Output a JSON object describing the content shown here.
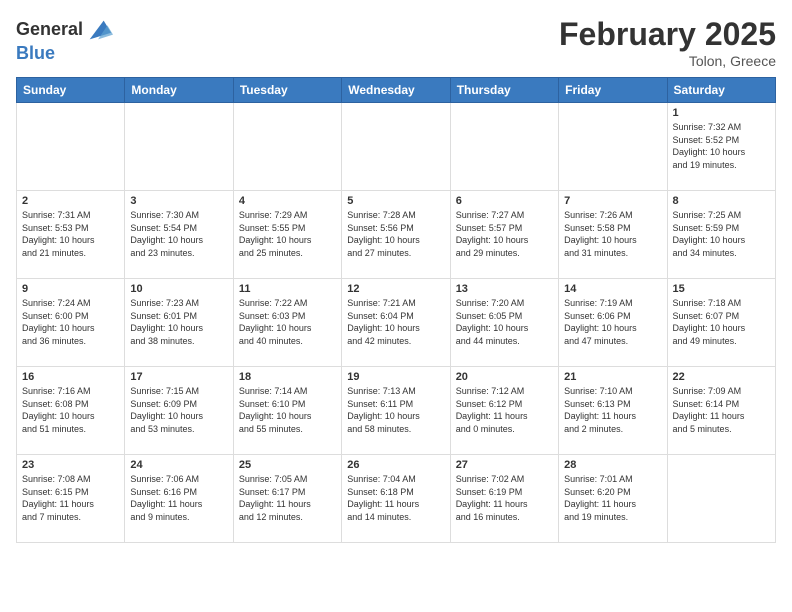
{
  "logo": {
    "general": "General",
    "blue": "Blue"
  },
  "header": {
    "month": "February 2025",
    "location": "Tolon, Greece"
  },
  "weekdays": [
    "Sunday",
    "Monday",
    "Tuesday",
    "Wednesday",
    "Thursday",
    "Friday",
    "Saturday"
  ],
  "weeks": [
    [
      {
        "day": "",
        "info": ""
      },
      {
        "day": "",
        "info": ""
      },
      {
        "day": "",
        "info": ""
      },
      {
        "day": "",
        "info": ""
      },
      {
        "day": "",
        "info": ""
      },
      {
        "day": "",
        "info": ""
      },
      {
        "day": "1",
        "info": "Sunrise: 7:32 AM\nSunset: 5:52 PM\nDaylight: 10 hours\nand 19 minutes."
      }
    ],
    [
      {
        "day": "2",
        "info": "Sunrise: 7:31 AM\nSunset: 5:53 PM\nDaylight: 10 hours\nand 21 minutes."
      },
      {
        "day": "3",
        "info": "Sunrise: 7:30 AM\nSunset: 5:54 PM\nDaylight: 10 hours\nand 23 minutes."
      },
      {
        "day": "4",
        "info": "Sunrise: 7:29 AM\nSunset: 5:55 PM\nDaylight: 10 hours\nand 25 minutes."
      },
      {
        "day": "5",
        "info": "Sunrise: 7:28 AM\nSunset: 5:56 PM\nDaylight: 10 hours\nand 27 minutes."
      },
      {
        "day": "6",
        "info": "Sunrise: 7:27 AM\nSunset: 5:57 PM\nDaylight: 10 hours\nand 29 minutes."
      },
      {
        "day": "7",
        "info": "Sunrise: 7:26 AM\nSunset: 5:58 PM\nDaylight: 10 hours\nand 31 minutes."
      },
      {
        "day": "8",
        "info": "Sunrise: 7:25 AM\nSunset: 5:59 PM\nDaylight: 10 hours\nand 34 minutes."
      }
    ],
    [
      {
        "day": "9",
        "info": "Sunrise: 7:24 AM\nSunset: 6:00 PM\nDaylight: 10 hours\nand 36 minutes."
      },
      {
        "day": "10",
        "info": "Sunrise: 7:23 AM\nSunset: 6:01 PM\nDaylight: 10 hours\nand 38 minutes."
      },
      {
        "day": "11",
        "info": "Sunrise: 7:22 AM\nSunset: 6:03 PM\nDaylight: 10 hours\nand 40 minutes."
      },
      {
        "day": "12",
        "info": "Sunrise: 7:21 AM\nSunset: 6:04 PM\nDaylight: 10 hours\nand 42 minutes."
      },
      {
        "day": "13",
        "info": "Sunrise: 7:20 AM\nSunset: 6:05 PM\nDaylight: 10 hours\nand 44 minutes."
      },
      {
        "day": "14",
        "info": "Sunrise: 7:19 AM\nSunset: 6:06 PM\nDaylight: 10 hours\nand 47 minutes."
      },
      {
        "day": "15",
        "info": "Sunrise: 7:18 AM\nSunset: 6:07 PM\nDaylight: 10 hours\nand 49 minutes."
      }
    ],
    [
      {
        "day": "16",
        "info": "Sunrise: 7:16 AM\nSunset: 6:08 PM\nDaylight: 10 hours\nand 51 minutes."
      },
      {
        "day": "17",
        "info": "Sunrise: 7:15 AM\nSunset: 6:09 PM\nDaylight: 10 hours\nand 53 minutes."
      },
      {
        "day": "18",
        "info": "Sunrise: 7:14 AM\nSunset: 6:10 PM\nDaylight: 10 hours\nand 55 minutes."
      },
      {
        "day": "19",
        "info": "Sunrise: 7:13 AM\nSunset: 6:11 PM\nDaylight: 10 hours\nand 58 minutes."
      },
      {
        "day": "20",
        "info": "Sunrise: 7:12 AM\nSunset: 6:12 PM\nDaylight: 11 hours\nand 0 minutes."
      },
      {
        "day": "21",
        "info": "Sunrise: 7:10 AM\nSunset: 6:13 PM\nDaylight: 11 hours\nand 2 minutes."
      },
      {
        "day": "22",
        "info": "Sunrise: 7:09 AM\nSunset: 6:14 PM\nDaylight: 11 hours\nand 5 minutes."
      }
    ],
    [
      {
        "day": "23",
        "info": "Sunrise: 7:08 AM\nSunset: 6:15 PM\nDaylight: 11 hours\nand 7 minutes."
      },
      {
        "day": "24",
        "info": "Sunrise: 7:06 AM\nSunset: 6:16 PM\nDaylight: 11 hours\nand 9 minutes."
      },
      {
        "day": "25",
        "info": "Sunrise: 7:05 AM\nSunset: 6:17 PM\nDaylight: 11 hours\nand 12 minutes."
      },
      {
        "day": "26",
        "info": "Sunrise: 7:04 AM\nSunset: 6:18 PM\nDaylight: 11 hours\nand 14 minutes."
      },
      {
        "day": "27",
        "info": "Sunrise: 7:02 AM\nSunset: 6:19 PM\nDaylight: 11 hours\nand 16 minutes."
      },
      {
        "day": "28",
        "info": "Sunrise: 7:01 AM\nSunset: 6:20 PM\nDaylight: 11 hours\nand 19 minutes."
      },
      {
        "day": "",
        "info": ""
      }
    ]
  ]
}
